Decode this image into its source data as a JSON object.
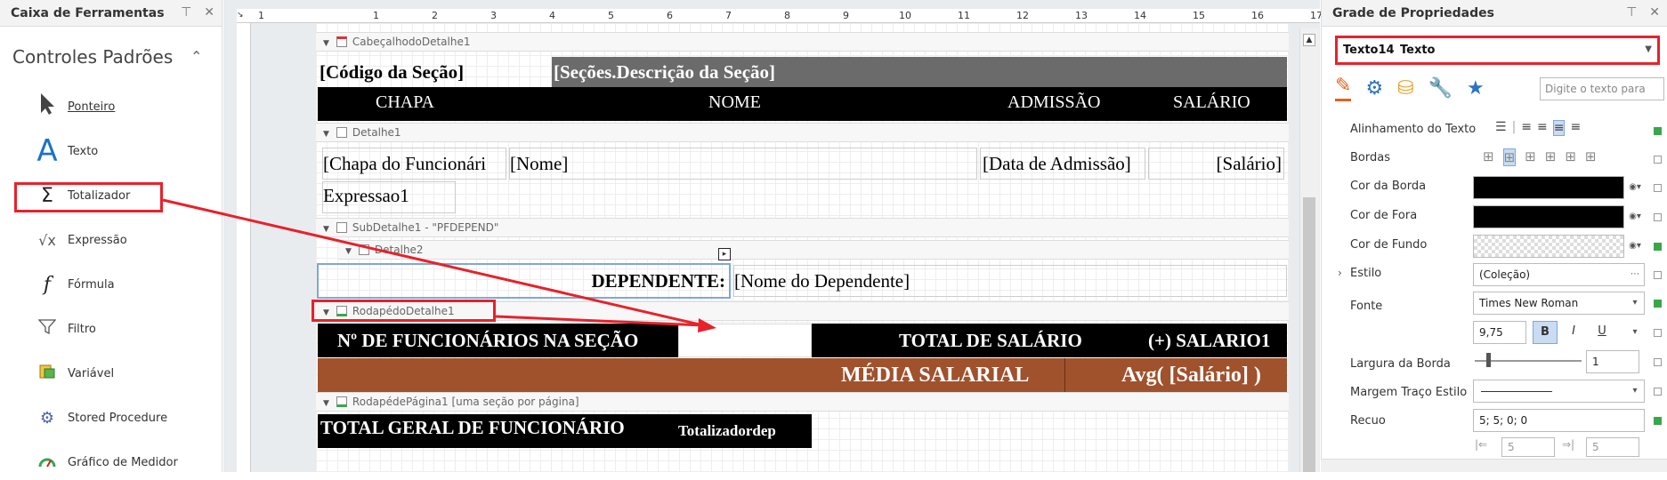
{
  "toolbox": {
    "title": "Caixa de Ferramentas",
    "group": "Controles Padrões",
    "items": [
      {
        "label": "Ponteiro",
        "icon": "pointer-icon"
      },
      {
        "label": "Texto",
        "icon": "text-icon"
      },
      {
        "label": "Totalizador",
        "icon": "sigma-icon"
      },
      {
        "label": "Expressão",
        "icon": "sqrt-icon"
      },
      {
        "label": "Fórmula",
        "icon": "function-icon"
      },
      {
        "label": "Filtro",
        "icon": "filter-icon"
      },
      {
        "label": "Variável",
        "icon": "variable-icon"
      },
      {
        "label": "Stored Procedure",
        "icon": "gear-icon"
      },
      {
        "label": "Gráfico de Medidor",
        "icon": "gauge-icon"
      }
    ]
  },
  "ruler": {
    "numbers": [
      "1",
      "1",
      "2",
      "3",
      "4",
      "5",
      "6",
      "7",
      "8",
      "9",
      "10",
      "11",
      "12",
      "13",
      "14",
      "15",
      "16",
      "17"
    ]
  },
  "report": {
    "bands": {
      "header_detail": "CabeçalhodoDetalhe1",
      "detail": "Detalhe1",
      "subdetail": "SubDetalhe1 - \"PFDEPEND\"",
      "detail2": "Detalhe2",
      "footer_detail": "RodapédoDetalhe1",
      "page_footer": "RodapédePágina1 [uma seção por página]"
    },
    "section_code": "[Código da Seção]",
    "section_desc": "[Seções.Descrição da Seção]",
    "col_chapa": "CHAPA",
    "col_nome": "NOME",
    "col_admissao": "ADMISSÃO",
    "col_salario": "SALÁRIO",
    "f_chapa": "[Chapa do Funcionári",
    "f_nome": "[Nome]",
    "f_admissao": "[Data de Admissão]",
    "f_salario": "[Salário]",
    "f_expr": "Expressao1",
    "dependente_label": "DEPENDENTE:",
    "dependente_name": "[Nome do Dependente]",
    "num_func": "Nº DE FUNCIONÁRIOS NA SEÇÃO",
    "total_salario": "TOTAL DE SALÁRIO",
    "mais_salario": "(+) SALARIO1",
    "media_salarial": "MÉDIA SALARIAL",
    "avg_salario": "Avg( [Salário] )",
    "total_geral": "TOTAL GERAL DE FUNCIONÁRIO",
    "totalizador": "Totalizadordep"
  },
  "props": {
    "title": "Grade de Propriedades",
    "selected": "Texto14",
    "selected_type": "Texto",
    "search_placeholder": "Digite o texto para",
    "rows": {
      "align": "Alinhamento do Texto",
      "bordas": "Bordas",
      "cor_borda": "Cor da Borda",
      "cor_fora": "Cor de Fora",
      "cor_fundo": "Cor de Fundo",
      "estilo": "Estilo",
      "estilo_val": "(Coleção)",
      "fonte": "Fonte",
      "fonte_val": "Times New Roman",
      "size_val": "9,75",
      "largura": "Largura da Borda",
      "largura_val": "1",
      "margem": "Margem Traço Estilo",
      "recuo": "Recuo",
      "recuo_val": "5; 5; 0; 0",
      "recuo_a": "5",
      "recuo_b": "5"
    }
  },
  "colors": {
    "red": "#e8212a",
    "brown": "#a0522d",
    "blue_icon": "#1a73c9"
  }
}
